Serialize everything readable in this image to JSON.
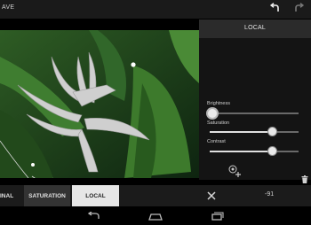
{
  "header": {
    "save_label": "AVE",
    "undo_icon": "undo-icon",
    "redo_icon": "redo-icon"
  },
  "panel": {
    "title": "LOCAL",
    "brightness": {
      "label": "Brightness",
      "value": 0.0
    },
    "saturation": {
      "label": "Saturation",
      "value": 0.7
    },
    "contrast": {
      "label": "Contrast",
      "value": 0.7
    }
  },
  "tabs": {
    "final": "INAL",
    "saturation": "SATURATION",
    "local": "LOCAL"
  },
  "status": {
    "value": "-91"
  },
  "colors": {
    "accent": "#e6e6e6",
    "panel": "#141414",
    "bar": "#1b1b1b"
  }
}
